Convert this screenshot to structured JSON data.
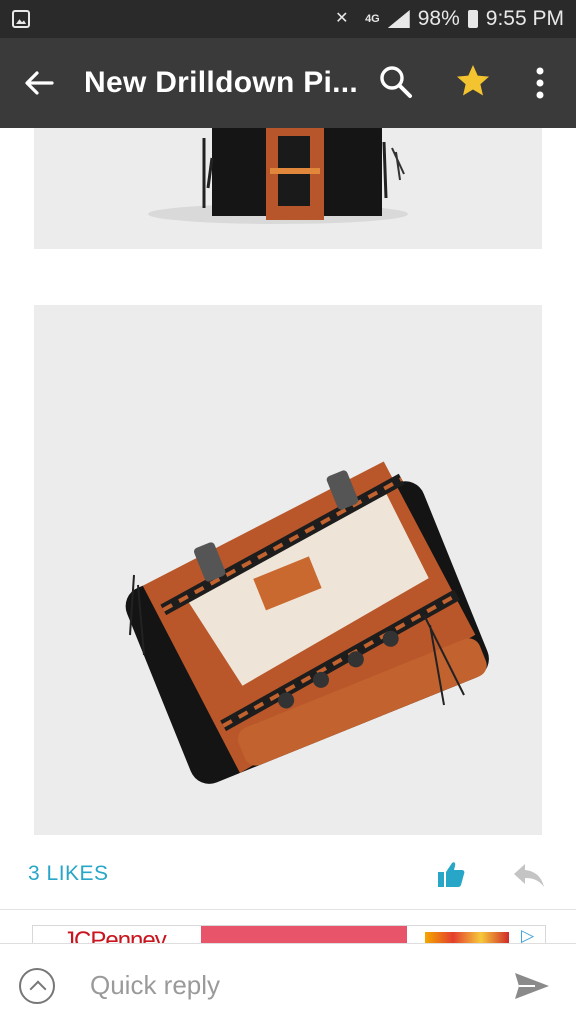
{
  "status_bar": {
    "network": "4G",
    "battery": "98%",
    "time": "9:55 PM"
  },
  "toolbar": {
    "title": "New Drilldown Pi...",
    "icons": [
      "back-arrow-icon",
      "search-icon",
      "star-icon",
      "more-vert-icon"
    ],
    "star_color": "#f4c430"
  },
  "post": {
    "likes_label": "3 LIKES",
    "accent": "#27a6c7"
  },
  "ad": {
    "brand": "JCPenney",
    "choice_icon": "adchoices-icon"
  },
  "reply": {
    "placeholder": "Quick reply"
  }
}
